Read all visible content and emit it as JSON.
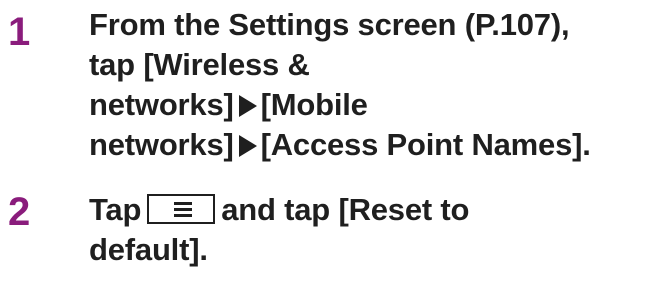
{
  "steps": [
    {
      "number": "1",
      "lines": {
        "l1": "From the Settings screen (P.107),",
        "l2": "tap [Wireless &",
        "l3a": "networks]",
        "l3b": "[Mobile",
        "l4a": "networks]",
        "l4b": "[Access Point Names]."
      }
    },
    {
      "number": "2",
      "lines": {
        "l1a": "Tap",
        "l1b": "and tap [Reset to",
        "l2": "default]."
      },
      "icon": "menu-key-icon"
    }
  ],
  "colors": {
    "step_number": "#8a1c7c",
    "text": "#1f1f1f"
  }
}
